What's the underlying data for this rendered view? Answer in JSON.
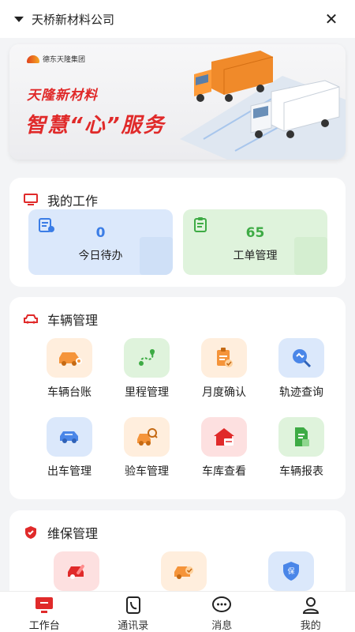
{
  "header": {
    "company": "天桥新材料公司"
  },
  "banner": {
    "logo_text": "德东天隆集团",
    "brand": "天隆新材料",
    "slogan": "智慧“心”服务"
  },
  "work": {
    "title": "我的工作",
    "tiles": [
      {
        "value": "0",
        "label": "今日待办",
        "color": "#3b7de6"
      },
      {
        "value": "65",
        "label": "工单管理",
        "color": "#3eab45"
      }
    ]
  },
  "vehicle": {
    "title": "车辆管理",
    "items": [
      {
        "label": "车辆台账",
        "icon": "car-ledger-icon"
      },
      {
        "label": "里程管理",
        "icon": "mileage-icon"
      },
      {
        "label": "月度确认",
        "icon": "monthly-confirm-icon"
      },
      {
        "label": "轨迹查询",
        "icon": "track-query-icon"
      },
      {
        "label": "出车管理",
        "icon": "dispatch-icon"
      },
      {
        "label": "验车管理",
        "icon": "inspection-icon"
      },
      {
        "label": "车库查看",
        "icon": "garage-icon"
      },
      {
        "label": "车辆报表",
        "icon": "report-icon"
      }
    ]
  },
  "maintenance": {
    "title": "维保管理"
  },
  "tabbar": [
    {
      "label": "工作台",
      "icon": "workbench-icon",
      "active": true
    },
    {
      "label": "通讯录",
      "icon": "contacts-icon"
    },
    {
      "label": "消息",
      "icon": "message-icon"
    },
    {
      "label": "我的",
      "icon": "profile-icon"
    }
  ],
  "colors": {
    "accent": "#e02a2a",
    "blue_tile": "#dbe8fb",
    "green_tile": "#dff3dc"
  }
}
